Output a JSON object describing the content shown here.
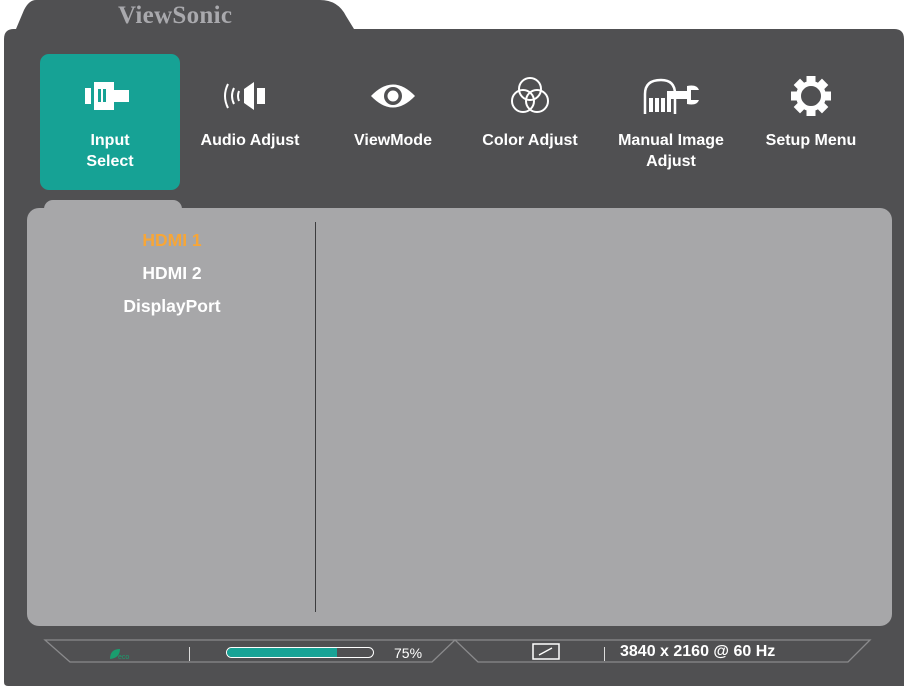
{
  "brand": "ViewSonic",
  "tabs": [
    {
      "label": "Input\nSelect",
      "icon": "input-select-icon",
      "active": true
    },
    {
      "label": "Audio Adjust",
      "icon": "audio-icon",
      "active": false
    },
    {
      "label": "ViewMode",
      "icon": "eye-icon",
      "active": false
    },
    {
      "label": "Color Adjust",
      "icon": "color-circles-icon",
      "active": false
    },
    {
      "label": "Manual Image\nAdjust",
      "icon": "hand-wrench-icon",
      "active": false
    },
    {
      "label": "Setup Menu",
      "icon": "gear-icon",
      "active": false
    }
  ],
  "inputs": [
    {
      "label": "HDMI 1",
      "selected": true
    },
    {
      "label": "HDMI 2",
      "selected": false
    },
    {
      "label": "DisplayPort",
      "selected": false
    }
  ],
  "status": {
    "eco_icon": "eco-leaf-icon",
    "brightness_percent": 75,
    "brightness_label": "75%",
    "resolution": "3840 x 2160 @ 60 Hz",
    "monitor_icon": "monitor-icon"
  },
  "colors": {
    "accent": "#16a295",
    "selected_text": "#f7a637",
    "frame": "#505052",
    "panel": "#a7a7a9"
  }
}
